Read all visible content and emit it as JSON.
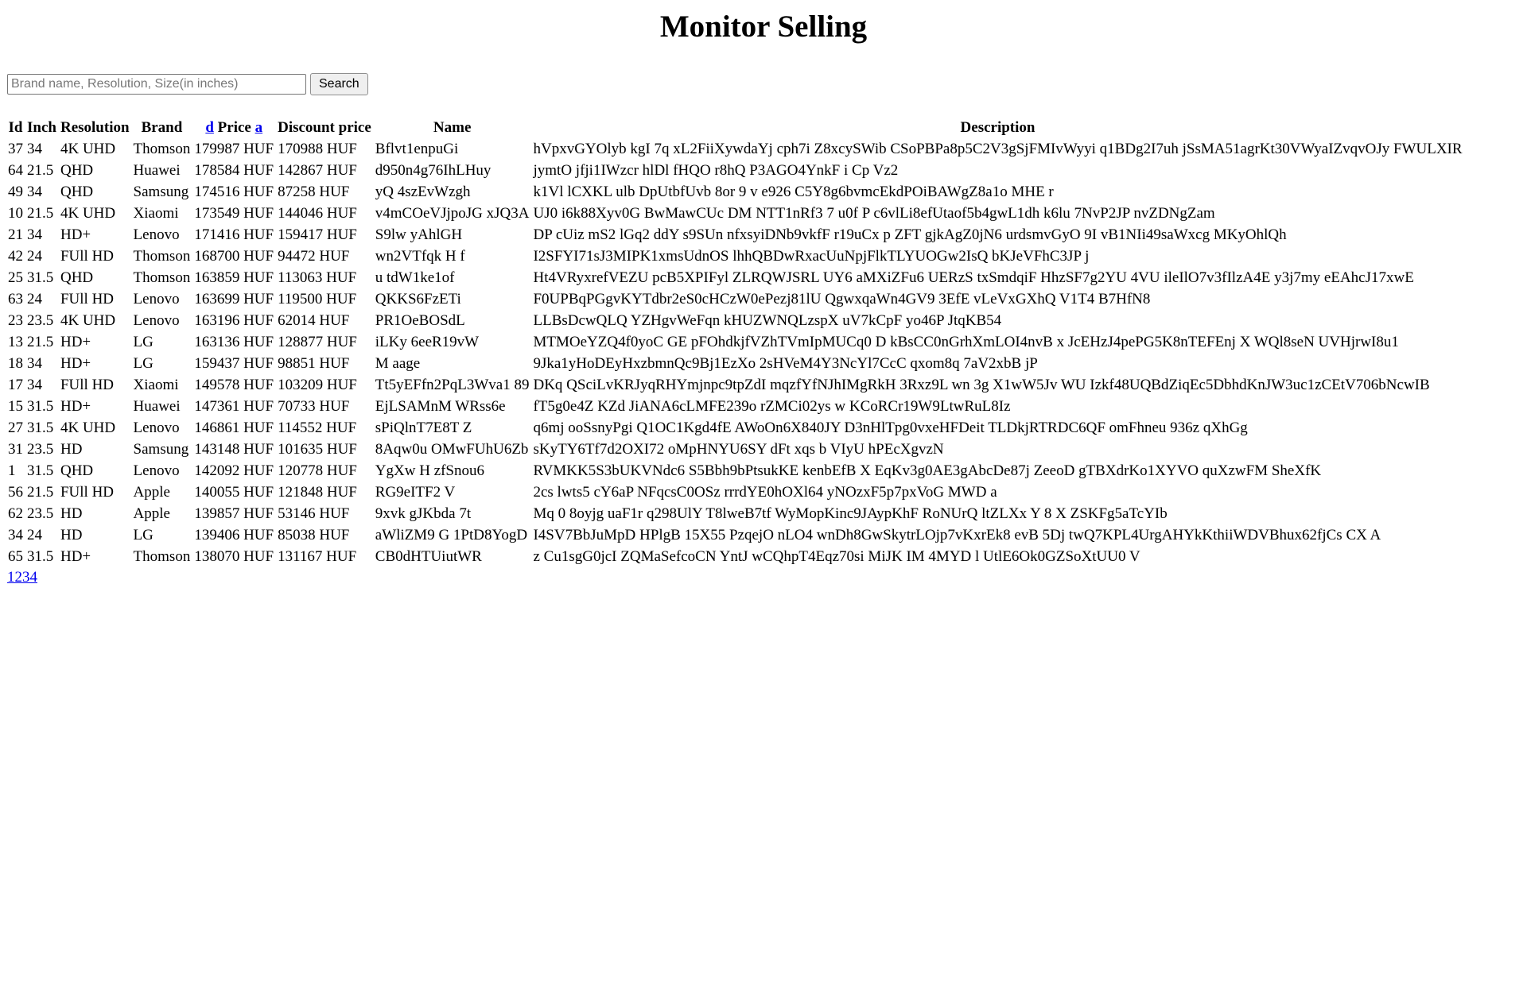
{
  "page": {
    "title": "Monitor Selling"
  },
  "search": {
    "placeholder": "Brand name, Resolution, Size(in inches)",
    "value": "",
    "button_label": "Search"
  },
  "table": {
    "headers": {
      "id": "Id",
      "inch": "Inch",
      "resolution": "Resolution",
      "brand": "Brand",
      "sort_desc": "d",
      "price": "Price",
      "sort_asc": "a",
      "discount_price": "Discount price",
      "name": "Name",
      "description": "Description"
    },
    "rows": [
      [
        "37",
        "34",
        "4K UHD",
        "Thomson",
        "179987 HUF",
        "170988 HUF",
        "Bflvt1enpuGi",
        "hVpxvGYOlyb kgI 7q xL2FiiXywdaYj cph7i Z8xcySWib CSoPBPa8p5C2V3gSjFMIvWyyi q1BDg2I7uh jSsMA51agrKt30VWyaIZvqvOJy FWULXIR"
      ],
      [
        "64",
        "21.5",
        "QHD",
        "Huawei",
        "178584 HUF",
        "142867 HUF",
        "d950n4g76IhLHuy",
        "jymtO jfji1IWzcr hlDl fHQO r8hQ P3AGO4YnkF i Cp Vz2"
      ],
      [
        "49",
        "34",
        "QHD",
        "Samsung",
        "174516 HUF",
        "87258 HUF",
        "yQ 4szEvWzgh",
        "k1Vl lCXKL ulb DpUtbfUvb 8or 9 v e926 C5Y8g6bvmcEkdPOiBAWgZ8a1o MHE r"
      ],
      [
        "10",
        "21.5",
        "4K UHD",
        "Xiaomi",
        "173549 HUF",
        "144046 HUF",
        "v4mCOeVJjpoJG xJQ3A",
        "UJ0 i6k88Xyv0G BwMawCUc DM NTT1nRf3 7 u0f P c6vlLi8efUtaof5b4gwL1dh k6lu 7NvP2JP nvZDNgZam"
      ],
      [
        "21",
        "34",
        "HD+",
        "Lenovo",
        "171416 HUF",
        "159417 HUF",
        "S9lw yAhlGH",
        "DP cUiz mS2 lGq2 ddY s9SUn nfxsyiDNb9vkfF r19uCx p ZFT gjkAgZ0jN6 urdsmvGyO 9I vB1NIi49saWxcg MKyOhlQh"
      ],
      [
        "42",
        "24",
        "FUll HD",
        "Thomson",
        "168700 HUF",
        "94472 HUF",
        "wn2VTfqk H f",
        "I2SFYI71sJ3MIPK1xmsUdnOS lhhQBDwRxacUuNpjFlkTLYUOGw2IsQ bKJeVFhC3JP j"
      ],
      [
        "25",
        "31.5",
        "QHD",
        "Thomson",
        "163859 HUF",
        "113063 HUF",
        "u tdW1ke1of",
        "Ht4VRyxrefVEZU pcB5XPIFyl ZLRQWJSRL UY6 aMXiZFu6 UERzS txSmdqiF HhzSF7g2YU 4VU ileIlO7v3fIlzA4E y3j7my eEAhcJ17xwE"
      ],
      [
        "63",
        "24",
        "FUll HD",
        "Lenovo",
        "163699 HUF",
        "119500 HUF",
        "QKKS6FzETi",
        "F0UPBqPGgvKYTdbr2eS0cHCzW0ePezj81lU QgwxqaWn4GV9 3EfE vLeVxGXhQ V1T4 B7HfN8"
      ],
      [
        "23",
        "23.5",
        "4K UHD",
        "Lenovo",
        "163196 HUF",
        "62014 HUF",
        "PR1OeBOSdL",
        "LLBsDcwQLQ YZHgvWeFqn kHUZWNQLzspX uV7kCpF yo46P JtqKB54"
      ],
      [
        "13",
        "21.5",
        "HD+",
        "LG",
        "163136 HUF",
        "128877 HUF",
        "iLKy 6eeR19vW",
        "MTMOeYZQ4f0yoC GE pFOhdkjfVZhTVmIpMUCq0 D kBsCC0nGrhXmLOI4nvB x JcEHzJ4pePG5K8nTEFEnj X WQl8seN UVHjrwI8u1"
      ],
      [
        "18",
        "34",
        "HD+",
        "LG",
        "159437 HUF",
        "98851 HUF",
        "M aage",
        "9Jka1yHoDEyHxzbmnQc9Bj1EzXo 2sHVeM4Y3NcYl7CcC qxom8q 7aV2xbB jP"
      ],
      [
        "17",
        "34",
        "FUll HD",
        "Xiaomi",
        "149578 HUF",
        "103209 HUF",
        "Tt5yEFfn2PqL3Wva1 89",
        "DKq QSciLvKRJyqRHYmjnpc9tpZdI mqzfYfNJhIMgRkH 3Rxz9L wn 3g X1wW5Jv WU Izkf48UQBdZiqEc5DbhdKnJW3uc1zCEtV706bNcwIB"
      ],
      [
        "15",
        "31.5",
        "HD+",
        "Huawei",
        "147361 HUF",
        "70733 HUF",
        "EjLSAMnM WRss6e",
        "fT5g0e4Z KZd JiANA6cLMFE239o rZMCi02ys w KCoRCr19W9LtwRuL8Iz"
      ],
      [
        "27",
        "31.5",
        "4K UHD",
        "Lenovo",
        "146861 HUF",
        "114552 HUF",
        "sPiQlnT7E8T Z",
        "q6mj ooSsnyPgi Q1OC1Kgd4fE AWoOn6X840JY D3nHlTpg0vxeHFDeit TLDkjRTRDC6QF omFhneu 936z qXhGg"
      ],
      [
        "31",
        "23.5",
        "HD",
        "Samsung",
        "143148 HUF",
        "101635 HUF",
        "8Aqw0u OMwFUhU6Zb",
        "sKyTY6Tf7d2OXI72 oMpHNYU6SY dFt xqs b VIyU hPEcXgvzN"
      ],
      [
        "1",
        "31.5",
        "QHD",
        "Lenovo",
        "142092 HUF",
        "120778 HUF",
        "YgXw H zfSnou6",
        "RVMKK5S3bUKVNdc6 S5Bbh9bPtsukKE kenbEfB X EqKv3g0AE3gAbcDe87j ZeeoD gTBXdrKo1XYVO quXzwFM SheXfK"
      ],
      [
        "56",
        "21.5",
        "FUll HD",
        "Apple",
        "140055 HUF",
        "121848 HUF",
        "RG9eITF2 V",
        "2cs lwts5 cY6aP NFqcsC0OSz rrrdYE0hOXl64 yNOzxF5p7pxVoG MWD a"
      ],
      [
        "62",
        "23.5",
        "HD",
        "Apple",
        "139857 HUF",
        "53146 HUF",
        "9xvk gJKbda 7t",
        "Mq 0 8oyjg uaF1r q298UlY T8lweB7tf WyMopKinc9JAypKhF RoNUrQ ltZLXx Y 8 X ZSKFg5aTcYIb"
      ],
      [
        "34",
        "24",
        "HD",
        "LG",
        "139406 HUF",
        "85038 HUF",
        "aWliZM9 G 1PtD8YogD",
        "I4SV7BbJuMpD HPlgB 15X55 PzqejO nLO4 wnDh8GwSkytrLOjp7vKxrEk8 evB 5Dj twQ7KPL4UrgAHYkKthiiWDVBhux62fjCs CX A"
      ],
      [
        "65",
        "31.5",
        "HD+",
        "Thomson",
        "138070 HUF",
        "131167 HUF",
        "CB0dHTUiutWR",
        "z Cu1sgG0jcI ZQMaSefcoCN YntJ wCQhpT4Eqz70si MiJK IM 4MYD l UtlE6Ok0GZSoXtUU0 V"
      ]
    ]
  },
  "pagination": {
    "pages": [
      "1",
      "2",
      "3",
      "4"
    ]
  },
  "colors": {
    "link": "#0000ee",
    "text": "#000000",
    "background": "#ffffff"
  }
}
